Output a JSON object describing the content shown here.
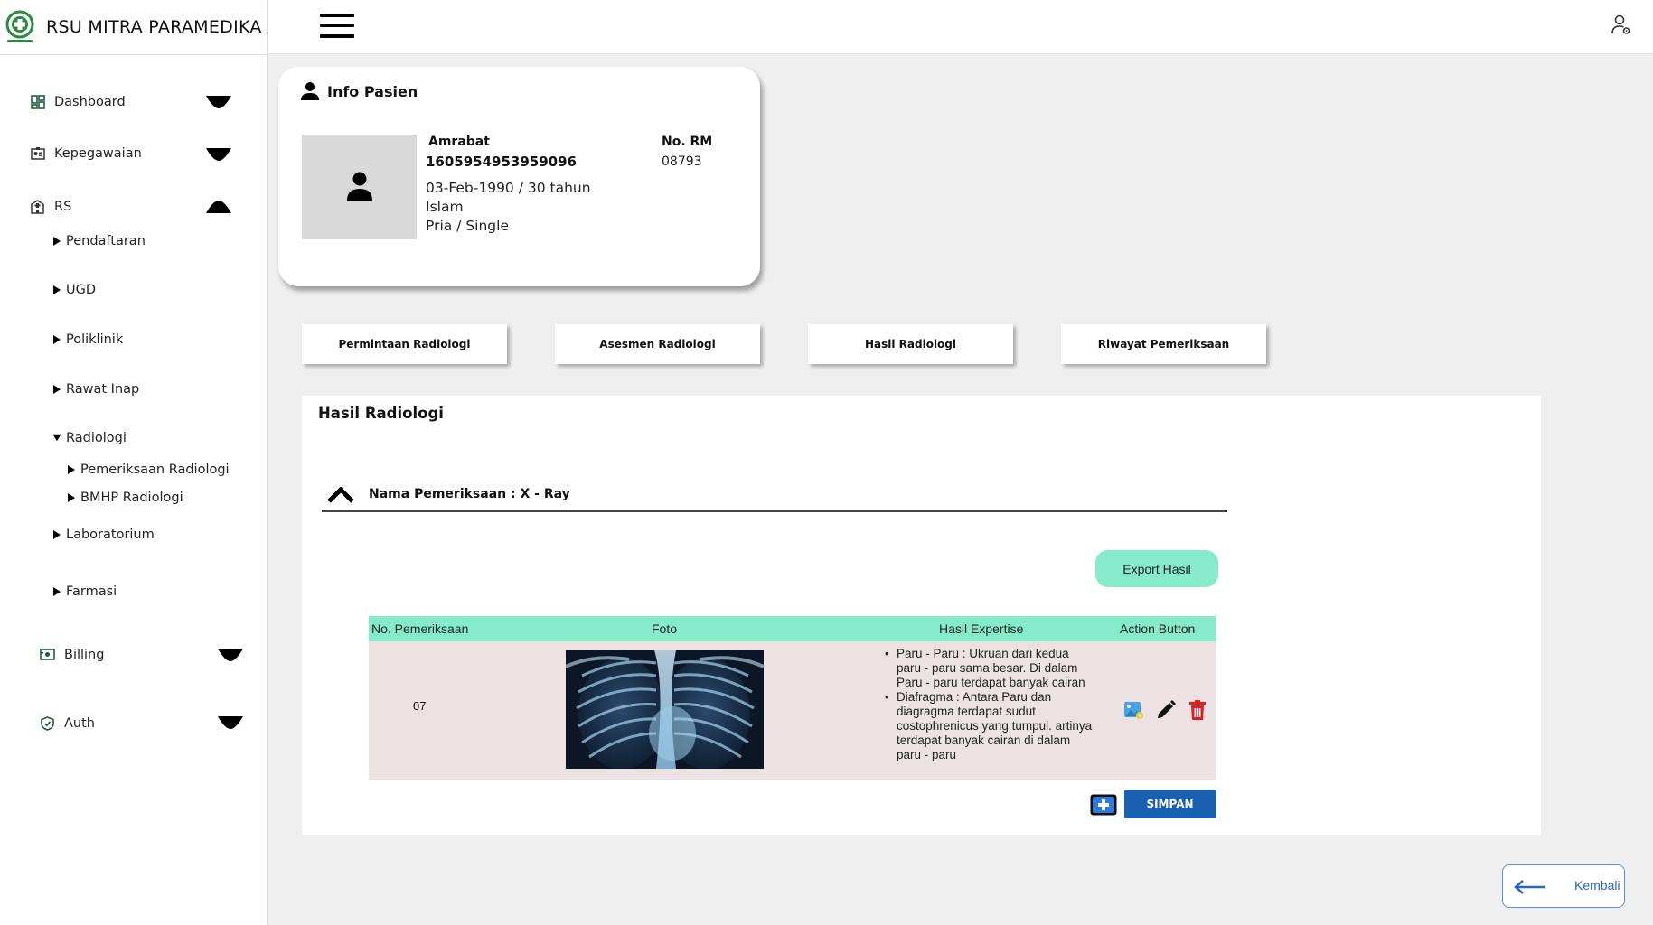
{
  "app": {
    "title": "RSU MITRA PARAMEDIKA"
  },
  "sidebar": {
    "items": [
      {
        "label": "Dashboard",
        "icon": "dashboard-icon"
      },
      {
        "label": "Kepegawaian",
        "icon": "id-card-icon"
      },
      {
        "label": "RS",
        "icon": "hospital-icon"
      },
      {
        "label": "Billing",
        "icon": "billing-icon"
      },
      {
        "label": "Auth",
        "icon": "shield-icon"
      }
    ],
    "rs_sub": [
      "Pendaftaran",
      "UGD",
      "Poliklinik",
      "Rawat Inap",
      "Radiologi",
      "Laboratorium",
      "Farmasi"
    ],
    "radiologi_sub": [
      "Pemeriksaan Radiologi",
      "BMHP Radiologi"
    ]
  },
  "patient": {
    "card_title": "Info Pasien",
    "name": "Amrabat",
    "nik": "1605954953959096",
    "dob_age": "03-Feb-1990 / 30 tahun",
    "religion": "Islam",
    "gender_status": "Pria / Single",
    "rm_label": "No. RM",
    "rm_value": "08793"
  },
  "tabs": [
    "Permintaan Radiologi",
    "Asesmen Radiologi",
    "Hasil Radiologi",
    "Riwayat Pemeriksaan"
  ],
  "main": {
    "title": "Hasil Radiologi",
    "exam_label": "Nama Pemeriksaan :  X - Ray",
    "export_label": "Export Hasil",
    "table": {
      "headers": [
        "No. Pemeriksaan",
        "Foto",
        "Hasil Expertise",
        "Action Button"
      ],
      "row": {
        "no": "07",
        "expertise": [
          "Paru - Paru : Ukruan dari kedua paru - paru sama besar. Di dalam Paru - paru terdapat banyak cairan",
          "Diafragma : Antara Paru dan diagragma terdapat sudut costophrenicus yang tumpul. artinya terdapat banyak cairan di dalam paru - paru"
        ]
      }
    },
    "simpan_label": "SIMPAN"
  },
  "back_label": "Kembali",
  "colors": {
    "accent_green": "#86ebcb",
    "primary_blue": "#1a5fb0",
    "row_bg": "#ece2e2",
    "delete_red": "#e21d1d"
  }
}
